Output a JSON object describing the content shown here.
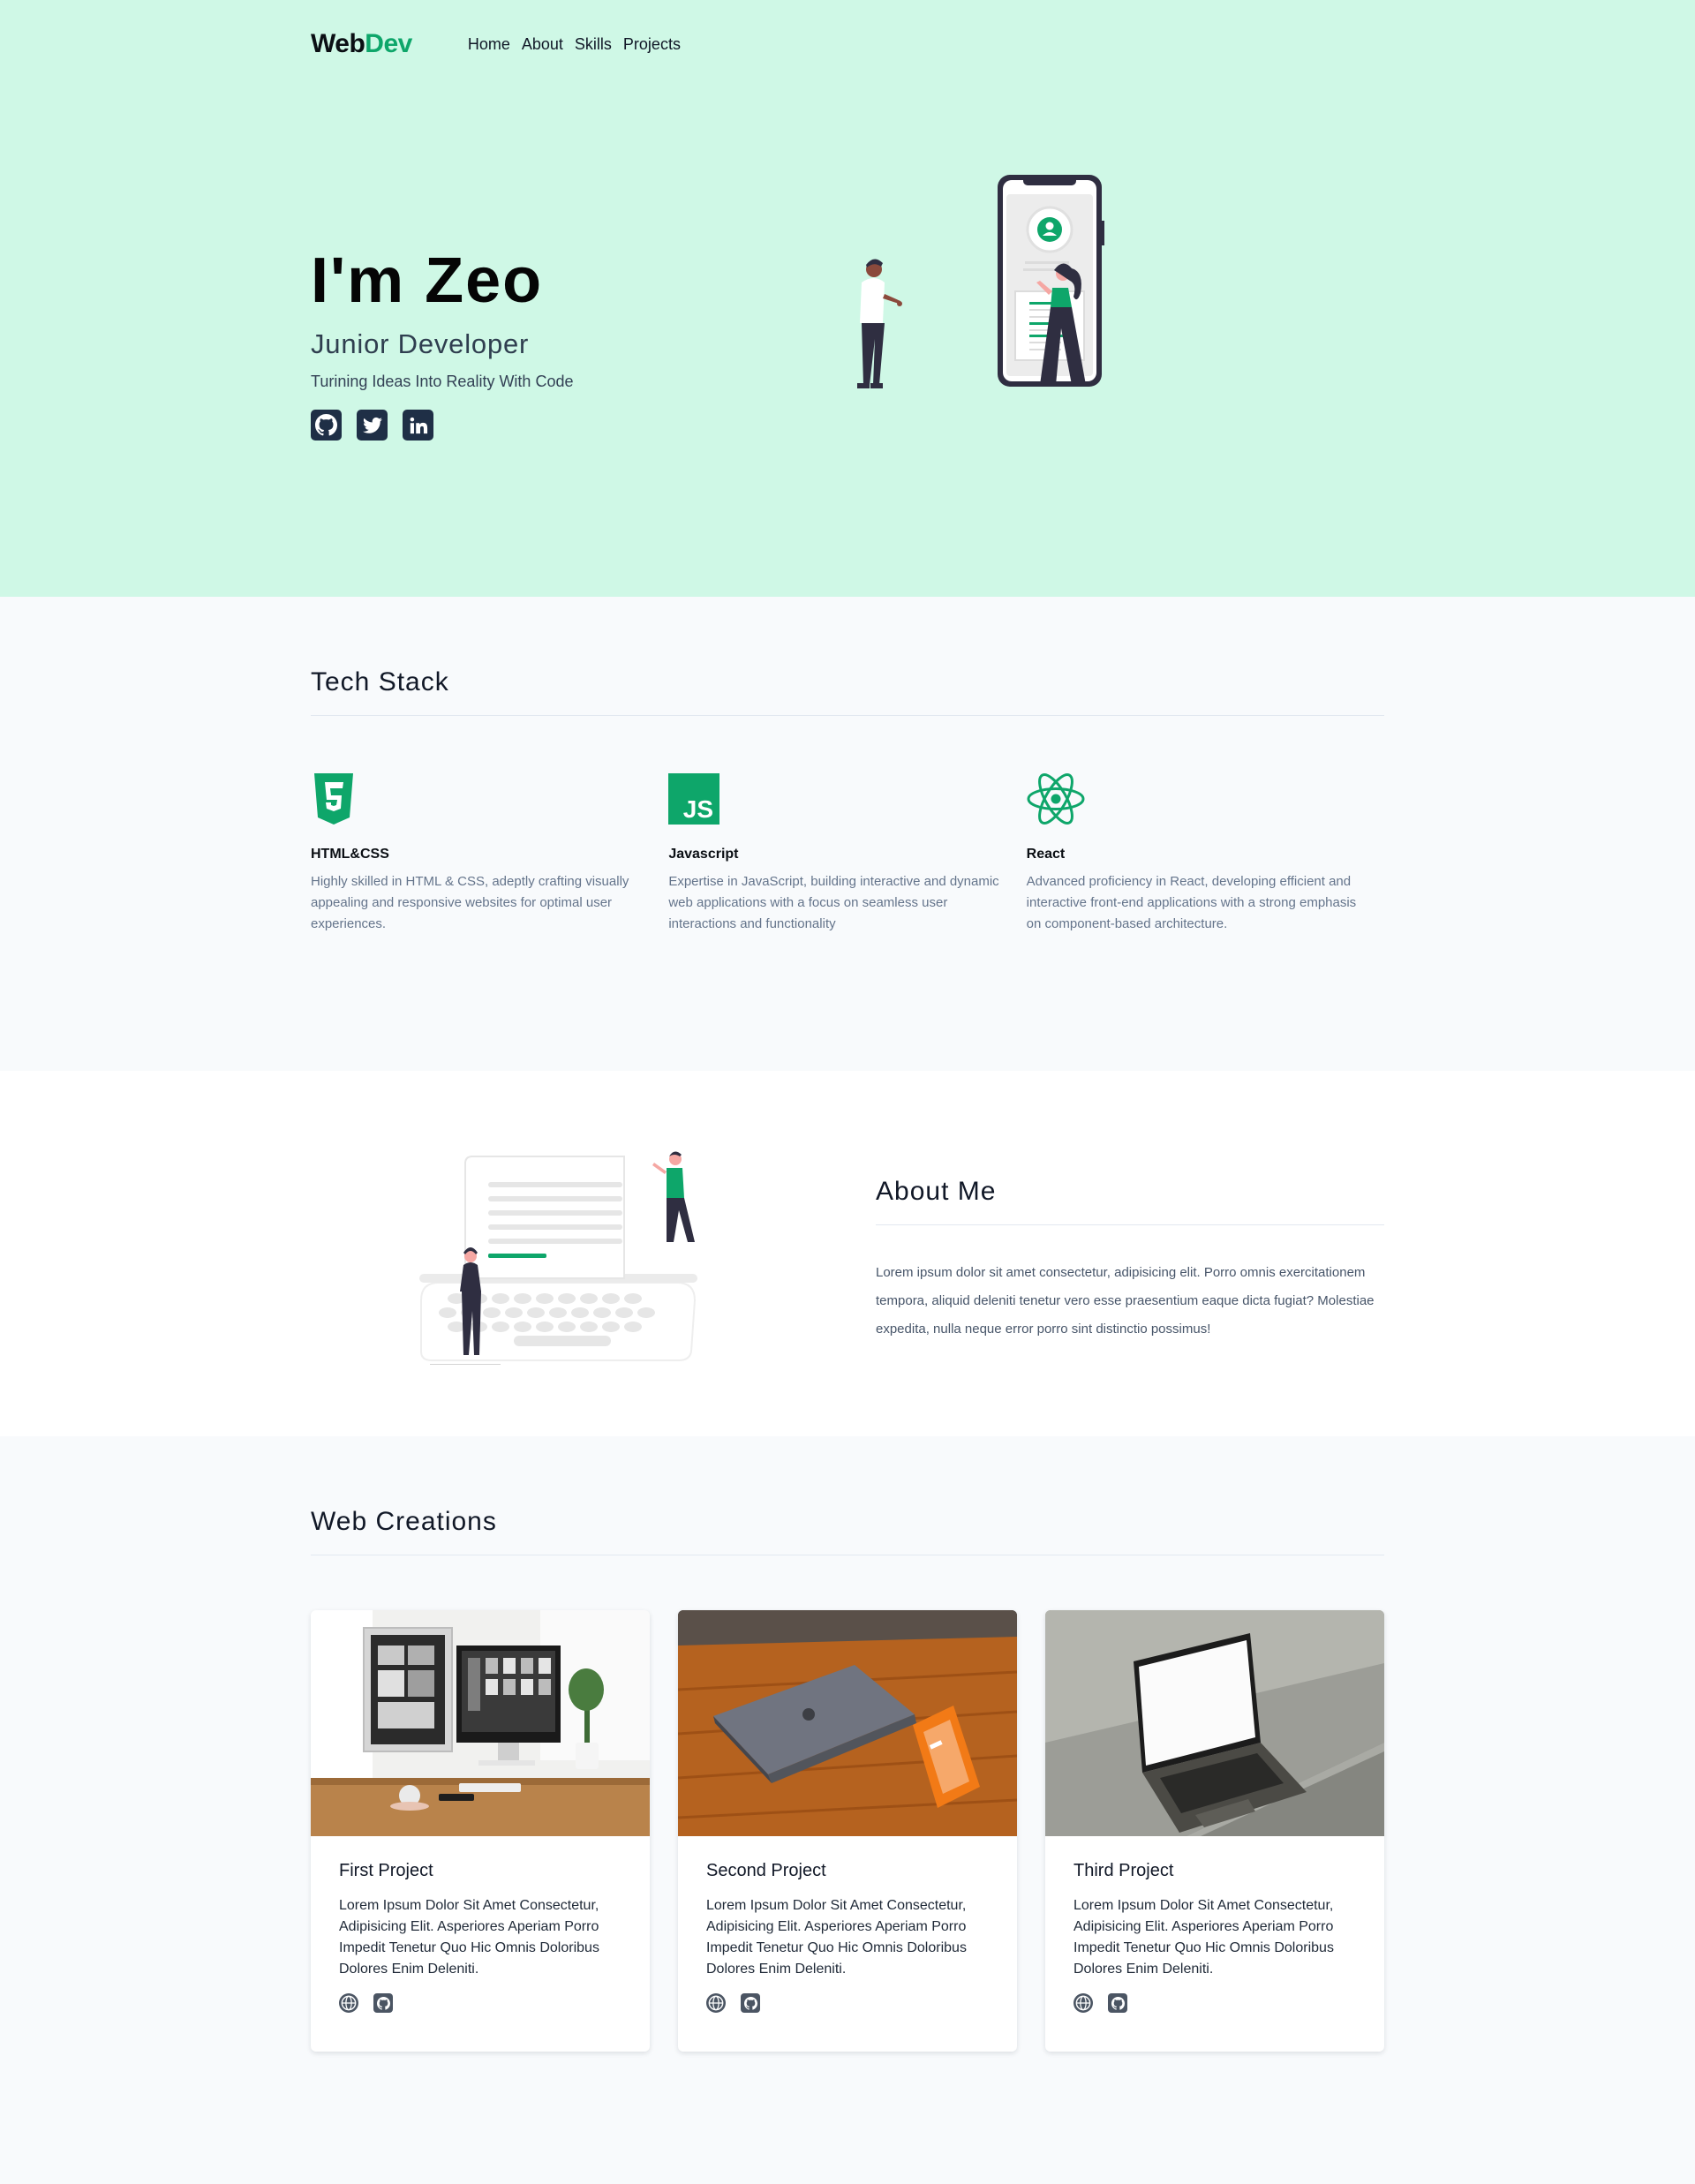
{
  "nav": {
    "brand_part1": "Web",
    "brand_part2": "Dev",
    "links": [
      "Home",
      "About",
      "Skills",
      "Projects"
    ]
  },
  "hero": {
    "title": "I'm Zeo",
    "subtitle": "Junior Developer",
    "tagline": "Turining Ideas Into Reality With Code",
    "socials": [
      "github-icon",
      "twitter-icon",
      "linkedin-icon"
    ]
  },
  "tech": {
    "title": "Tech Stack",
    "items": [
      {
        "icon": "html5-icon",
        "name": "HTML&CSS",
        "desc": "Highly skilled in HTML & CSS, adeptly crafting visually appealing and responsive websites for optimal user experiences."
      },
      {
        "icon": "javascript-icon",
        "icon_text": "JS",
        "name": "Javascript",
        "desc": "Expertise in JavaScript, building interactive and dynamic web applications with a focus on seamless user interactions and functionality"
      },
      {
        "icon": "react-icon",
        "name": "React",
        "desc": "Advanced proficiency in React, developing efficient and interactive front-end applications with a strong emphasis on component-based architecture."
      }
    ]
  },
  "about": {
    "title": "About Me",
    "text": "Lorem ipsum dolor sit amet consectetur, adipisicing elit. Porro omnis exercitationem tempora, aliquid deleniti tenetur vero esse praesentium eaque dicta fugiat? Molestiae expedita, nulla neque error porro sint distinctio possimus!"
  },
  "projects": {
    "title": "Web Creations",
    "items": [
      {
        "title": "First Project",
        "desc": "Lorem Ipsum Dolor Sit Amet Consectetur, Adipisicing Elit. Asperiores Aperiam Porro Impedit Tenetur Quo Hic Omnis Doloribus Dolores Enim Deleniti.",
        "links": [
          "globe-icon",
          "github-icon"
        ]
      },
      {
        "title": "Second Project",
        "desc": "Lorem Ipsum Dolor Sit Amet Consectetur, Adipisicing Elit. Asperiores Aperiam Porro Impedit Tenetur Quo Hic Omnis Doloribus Dolores Enim Deleniti.",
        "links": [
          "globe-icon",
          "github-icon"
        ]
      },
      {
        "title": "Third Project",
        "desc": "Lorem Ipsum Dolor Sit Amet Consectetur, Adipisicing Elit. Asperiores Aperiam Porro Impedit Tenetur Quo Hic Omnis Doloribus Dolores Enim Deleniti.",
        "links": [
          "globe-icon",
          "github-icon"
        ]
      }
    ]
  },
  "colors": {
    "accent": "#0ea66a",
    "hero_bg": "#cff8e6",
    "dark_navy": "#1f2f46"
  }
}
